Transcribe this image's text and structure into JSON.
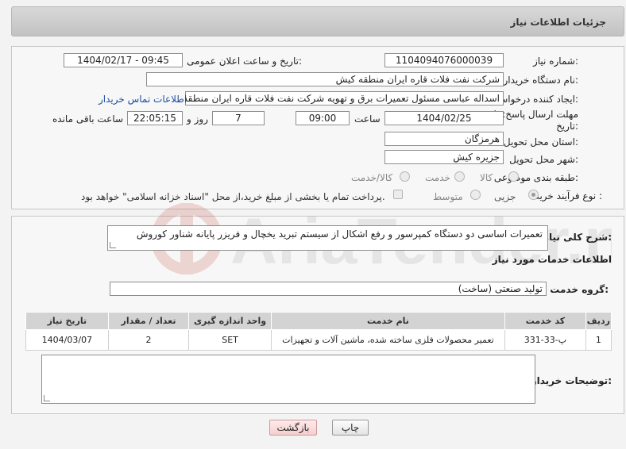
{
  "header": {
    "title": "جزئیات اطلاعات نیاز"
  },
  "fields": {
    "need_number_label": "شماره نیاز:",
    "need_number": "1104094076000039",
    "announce_label": "تاریخ و ساعت اعلان عمومی:",
    "announce_value": "1404/02/17 - 09:45",
    "buyer_org_label": "نام دستگاه خریدار:",
    "buyer_org": "شرکت نفت فلات قاره ایران منطقه کیش",
    "requester_label": "ایجاد کننده درخواست:",
    "requester": "اسداله  عباسی  مسئول تعمیرات برق و تهویه  شرکت نفت فلات قاره ایران منطقه کیش",
    "buyer_contact_link": "اطلاعات تماس خریدار",
    "deadline_label_1": "مهلت ارسال پاسخ: تا",
    "deadline_label_2": "تاریخ:",
    "deadline_date": "1404/02/25",
    "time_label": "ساعت",
    "deadline_time": "09:00",
    "days_value": "7",
    "days_label": "روز و",
    "remaining_time": "22:05:15",
    "remaining_label": "ساعت باقی مانده",
    "province_label": "استان محل تحویل:",
    "province": "هرمزگان",
    "city_label": "شهر محل تحویل:",
    "city": "جزیره کیش",
    "category_label": "طبقه بندی موضوعی:",
    "category_options": [
      "کالا",
      "خدمت",
      "کالا/خدمت"
    ],
    "process_label": "نوع فرآیند خرید :",
    "process_options": [
      "جزیی",
      "متوسط"
    ],
    "payment_note": "پرداخت تمام یا بخشی از مبلغ خرید،از محل \"اسناد خزانه اسلامی\" خواهد بود."
  },
  "description": {
    "label": "شرح کلی نیاز:",
    "text": "تعمیرات اساسی دو دستگاه کمپرسور و رفع اشکال از سیستم  تبرید یخچال و فریزر پایانه شناور کوروش"
  },
  "services": {
    "section_title": "اطلاعات خدمات مورد نیاز",
    "group_label": "گروه خدمت:",
    "group_value": "تولید صنعتی (ساخت)",
    "columns": [
      "ردیف",
      "کد خدمت",
      "نام خدمت",
      "واحد اندازه گیری",
      "تعداد / مقدار",
      "تاریخ نیاز"
    ],
    "rows": [
      [
        "1",
        "پ-33-331",
        "تعمیر محصولات فلزی ساخته شده، ماشین آلات و تجهیزات",
        "SET",
        "2",
        "1404/03/07"
      ]
    ]
  },
  "buyer_notes": {
    "label": "توضیحات خریدار:",
    "text": ""
  },
  "buttons": {
    "print": "چاپ",
    "back": "بازگشت"
  },
  "watermark": {
    "text": "AriaTender.neT"
  }
}
